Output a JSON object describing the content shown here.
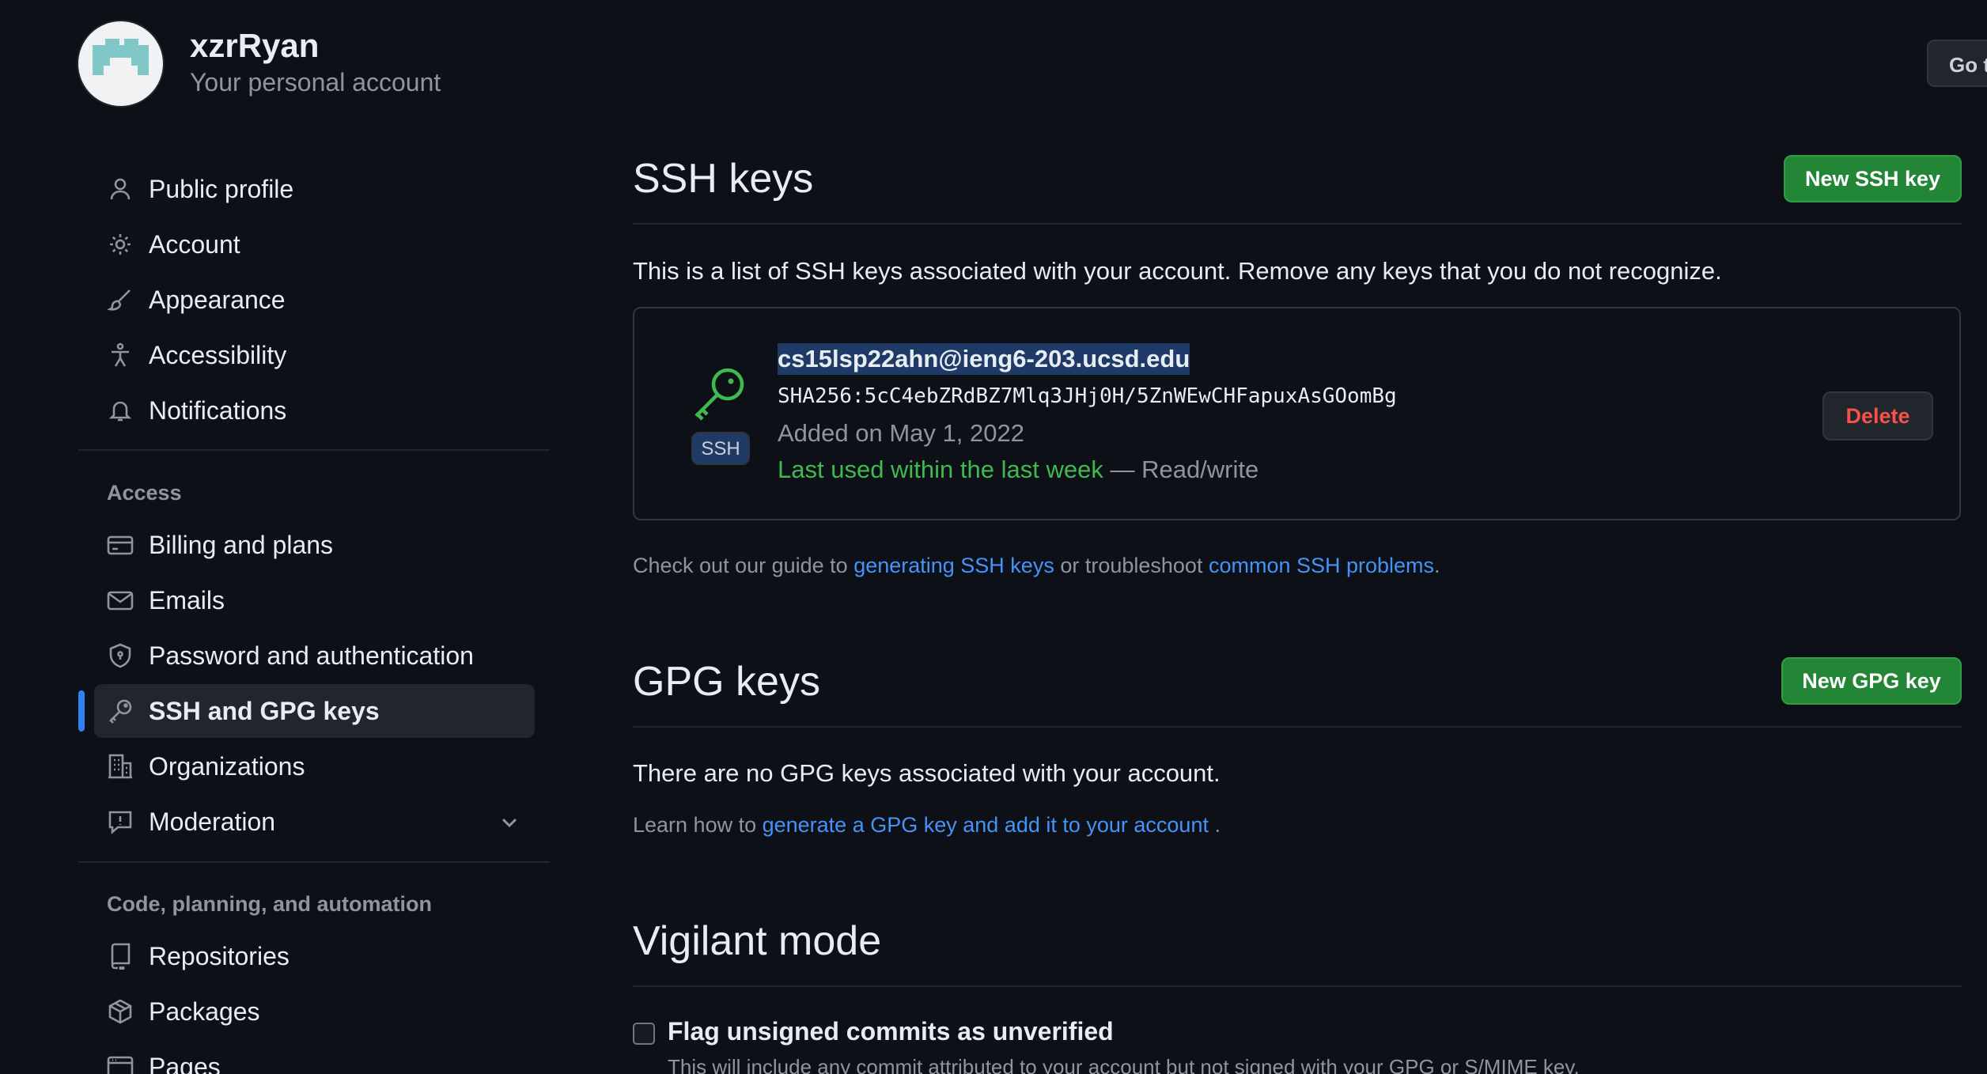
{
  "header": {
    "username": "xzrRyan",
    "subtitle": "Your personal account",
    "goto_button": "Go to your personal profile"
  },
  "sidebar": {
    "items": [
      {
        "label": "Public profile",
        "icon": "person-icon"
      },
      {
        "label": "Account",
        "icon": "gear-icon"
      },
      {
        "label": "Appearance",
        "icon": "paintbrush-icon"
      },
      {
        "label": "Accessibility",
        "icon": "accessibility-icon"
      },
      {
        "label": "Notifications",
        "icon": "bell-icon"
      }
    ],
    "access_heading": "Access",
    "access_items": [
      {
        "label": "Billing and plans",
        "icon": "credit-card-icon"
      },
      {
        "label": "Emails",
        "icon": "mail-icon"
      },
      {
        "label": "Password and authentication",
        "icon": "shield-lock-icon"
      },
      {
        "label": "SSH and GPG keys",
        "icon": "key-icon"
      },
      {
        "label": "Organizations",
        "icon": "organization-icon"
      },
      {
        "label": "Moderation",
        "icon": "report-icon"
      }
    ],
    "code_heading": "Code, planning, and automation",
    "code_items": [
      {
        "label": "Repositories",
        "icon": "repo-icon"
      },
      {
        "label": "Packages",
        "icon": "package-icon"
      },
      {
        "label": "Pages",
        "icon": "browser-icon"
      }
    ],
    "active_item": "SSH and GPG keys"
  },
  "ssh": {
    "title": "SSH keys",
    "new_button": "New SSH key",
    "description": "This is a list of SSH keys associated with your account. Remove any keys that you do not recognize.",
    "key": {
      "badge": "SSH",
      "title": "cs15lsp22ahn@ieng6-203.ucsd.edu",
      "fingerprint": "SHA256:5cC4ebZRdBZ7Mlq3JHj0H/5ZnWEwCHFapuxAsGOomBg",
      "added": "Added on May 1, 2022",
      "last_used": "Last used within the last week",
      "access": " — Read/write",
      "delete_button": "Delete"
    },
    "guide_prefix": "Check out our guide to ",
    "guide_link1": "generating SSH keys",
    "guide_middle": " or troubleshoot ",
    "guide_link2": "common SSH problems",
    "guide_suffix": "."
  },
  "gpg": {
    "title": "GPG keys",
    "new_button": "New GPG key",
    "empty_text": "There are no GPG keys associated with your account.",
    "learn_prefix": "Learn how to ",
    "learn_link": "generate a GPG key and add it to your account",
    "learn_suffix": " ."
  },
  "vigilant": {
    "title": "Vigilant mode",
    "checkbox_label": "Flag unsigned commits as unverified",
    "checkbox_checked": false,
    "checkbox_desc": "This will include any commit attributed to your account but not signed with your GPG or S/MIME key."
  },
  "colors": {
    "background": "#0d1117",
    "accent_blue": "#2f81f7",
    "link": "#4493f8",
    "primary_green": "#238636",
    "danger": "#f85149"
  }
}
